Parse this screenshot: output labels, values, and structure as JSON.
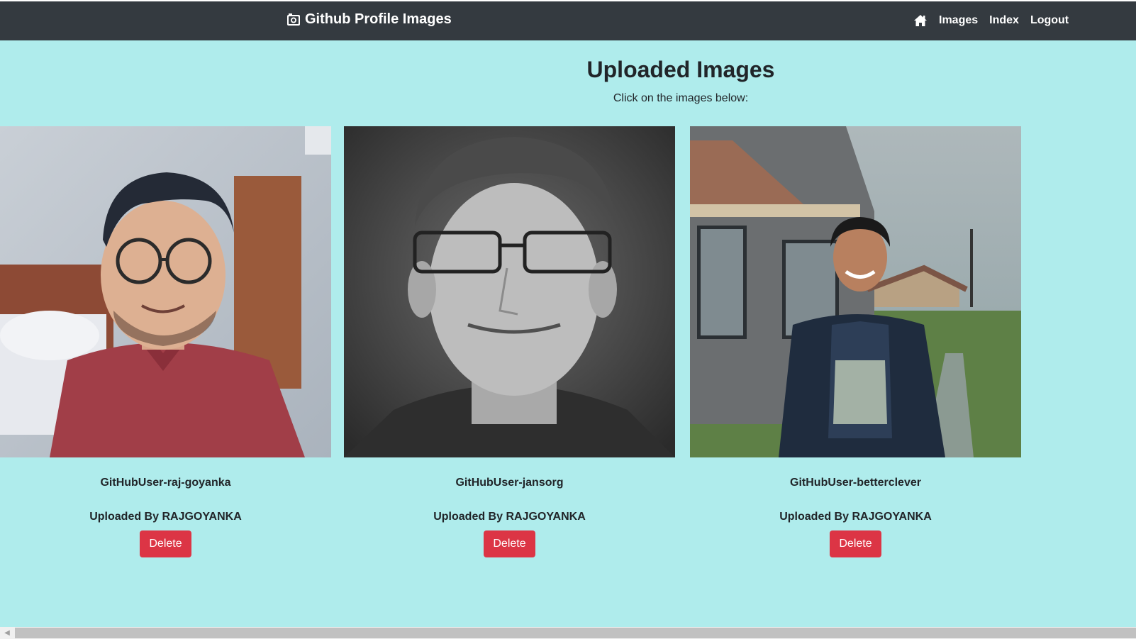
{
  "navbar": {
    "brand": "Github Profile Images",
    "links": [
      {
        "label": "Images"
      },
      {
        "label": "Index"
      },
      {
        "label": "Logout"
      }
    ],
    "icons": {
      "brand": "camera-icon",
      "home": "home-icon"
    }
  },
  "main": {
    "title": "Uploaded Images",
    "subtitle": "Click on the images below:"
  },
  "cards": [
    {
      "title": "GitHubUser-raj-goyanka",
      "uploader": "Uploaded By RAJGOYANKA",
      "delete_label": "Delete"
    },
    {
      "title": "GitHubUser-jansorg",
      "uploader": "Uploaded By RAJGOYANKA",
      "delete_label": "Delete"
    },
    {
      "title": "GitHubUser-betterclever",
      "uploader": "Uploaded By RAJGOYANKA",
      "delete_label": "Delete"
    }
  ],
  "colors": {
    "background": "#afecec",
    "navbar": "#343a40",
    "delete": "#dc3545",
    "text": "#212529"
  }
}
